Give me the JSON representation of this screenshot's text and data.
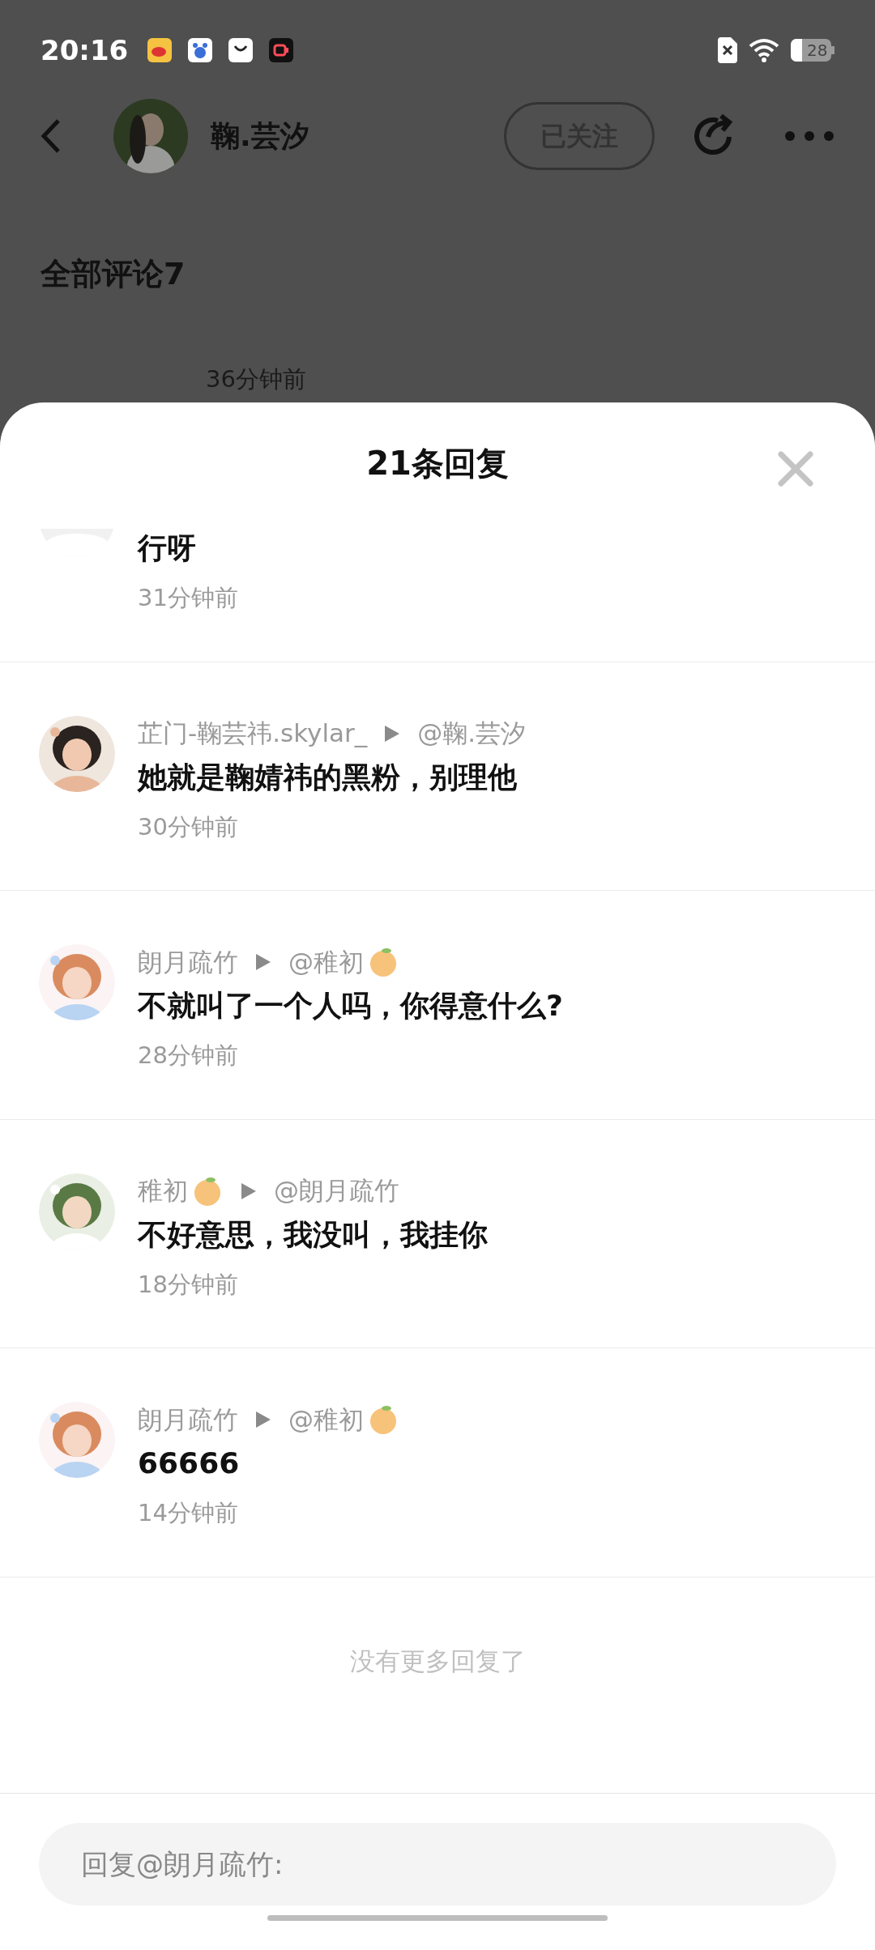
{
  "status_bar": {
    "time": "20:16",
    "battery": "28"
  },
  "header": {
    "user_name": "鞠.芸汐",
    "follow_button": "已关注",
    "following": true
  },
  "comments_heading": "全部评论7",
  "background_comment": {
    "time": "36分钟前"
  },
  "sheet": {
    "title": "21条回复",
    "replies": [
      {
        "text": "行呀",
        "time": "31分钟前"
      },
      {
        "author": "芷门-鞠芸祎.skylar_",
        "target": "@鞠.芸汐",
        "text": "她就是鞠婧祎的黑粉，别理他",
        "time": "30分钟前"
      },
      {
        "author": "朗月疏竹",
        "target": "@稚初",
        "target_badge": true,
        "text": "不就叫了一个人吗，你得意什么?",
        "time": "28分钟前"
      },
      {
        "author": "稚初",
        "author_badge": true,
        "target": "@朗月疏竹",
        "text": "不好意思，我没叫，我挂你",
        "time": "18分钟前"
      },
      {
        "author": "朗月疏竹",
        "target": "@稚初",
        "target_badge": true,
        "text": "66666",
        "time": "14分钟前"
      }
    ],
    "end_note": "没有更多回复了",
    "reply_field": {
      "placeholder": "回复@朗月疏竹:"
    }
  }
}
